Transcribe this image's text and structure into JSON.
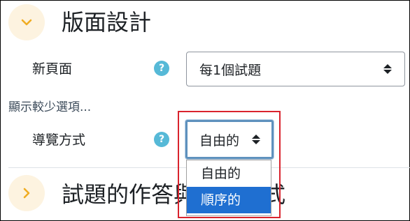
{
  "sections": [
    {
      "title": "版面設計",
      "icon": "chevron-down-icon",
      "expanded": true
    },
    {
      "title": "試題的作答與呈現方式",
      "icon": "chevron-right-icon",
      "expanded": false
    }
  ],
  "fields": {
    "new_page": {
      "label": "新頁面",
      "help": "?",
      "value": "每1個試題"
    },
    "navigation": {
      "label": "導覽方式",
      "help": "?",
      "value": "自由的"
    }
  },
  "show_less": "顯示較少選項...",
  "navigation_options": [
    {
      "label": "自由的",
      "selected": false
    },
    {
      "label": "順序的",
      "selected": true
    }
  ],
  "colors": {
    "accent": "#1f6fd1",
    "help": "#56b9d7",
    "chevron": "#f0ad23",
    "highlight": "#d9232d"
  }
}
